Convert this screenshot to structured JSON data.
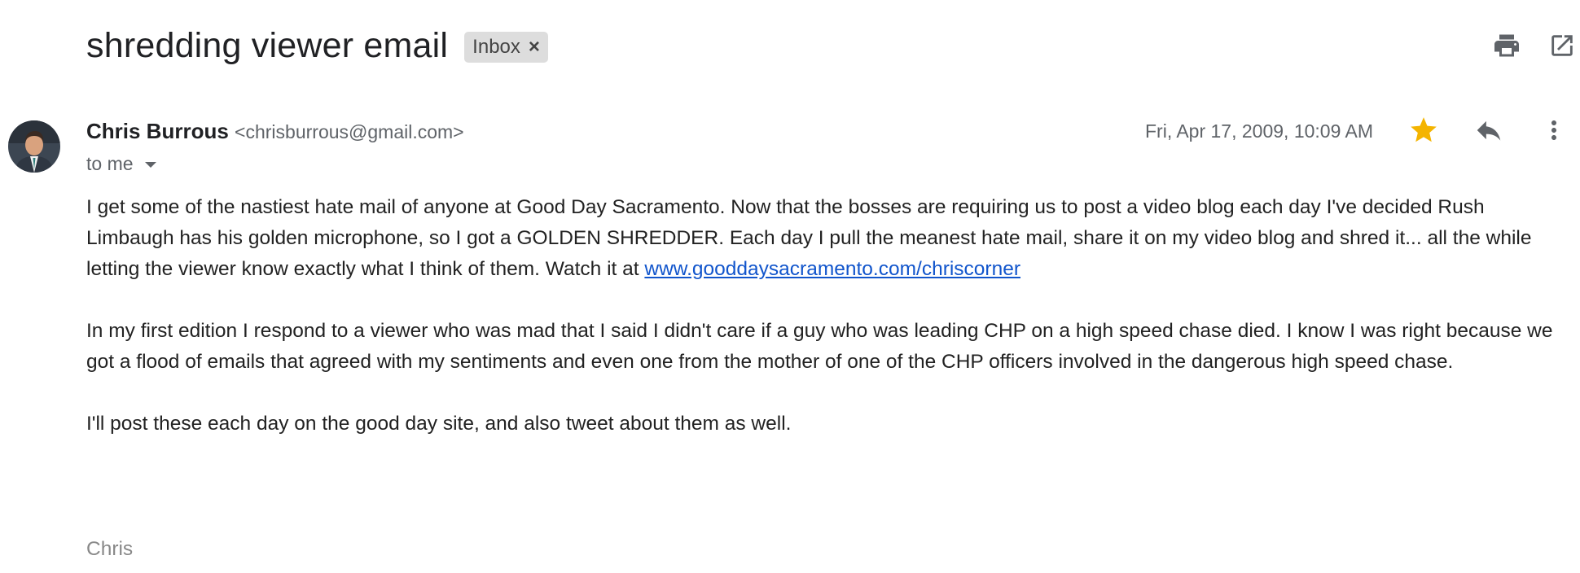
{
  "email": {
    "subject": "shredding viewer email",
    "label": "Inbox",
    "label_remove": "×",
    "sender_name": "Chris Burrous",
    "sender_email": "<chrisburrous@gmail.com>",
    "recipient": "to me",
    "date": "Fri, Apr 17, 2009, 10:09 AM",
    "starred": true,
    "body": {
      "p1_text": "I get some of the nastiest hate mail of anyone at Good Day Sacramento. Now that the bosses are requiring us to post a video blog each day I've decided Rush Limbaugh has his golden microphone, so I got a GOLDEN SHREDDER. Each day I pull the meanest hate mail, share it on my video blog and shred it... all the while letting the viewer know exactly what I think of them. Watch it at ",
      "p1_link": "www.gooddaysacramento.com/chriscorner",
      "p2": "In my first edition I respond to a viewer who was mad that I said I didn't care if a guy who was leading CHP on a high speed chase died. I know I was right because we got a flood of emails that agreed with my sentiments and even one from the mother of one of the CHP officers involved in the dangerous high speed chase.",
      "p3": "I'll post these each day on the good day site, and also tweet about them as well."
    },
    "signature": "Chris"
  },
  "icons": {
    "print": "print-icon",
    "open_new_window": "open-in-new-window-icon",
    "star": "star-icon",
    "reply": "reply-icon",
    "more": "more-vert-icon",
    "caret": "caret-down-icon"
  },
  "colors": {
    "star": "#f4b400",
    "link": "#1155cc",
    "icon": "#5f6368",
    "chip_bg": "#dddddd"
  }
}
